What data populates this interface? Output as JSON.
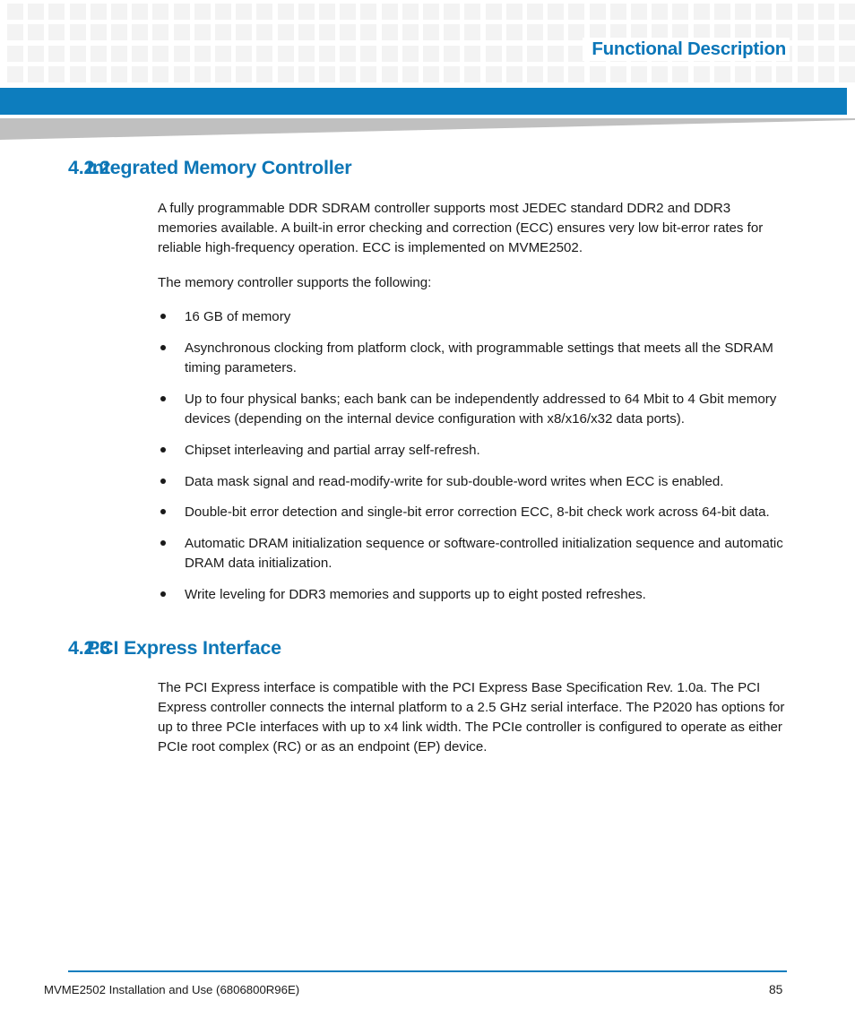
{
  "header": {
    "title": "Functional Description",
    "bar_color": "#0d7dbe",
    "wedge_color": "#c0c0c0",
    "grid_cell_color": "#f3f3f3"
  },
  "sections": [
    {
      "number": "4.2.2",
      "title": "Integrated Memory Controller",
      "paragraphs": [
        "A fully programmable DDR SDRAM controller supports most JEDEC standard DDR2 and DDR3 memories available. A built-in error checking and correction (ECC) ensures very low bit-error rates for reliable high-frequency operation. ECC is implemented on MVME2502.",
        "The memory controller supports the following:"
      ],
      "bullets": [
        "16 GB of memory",
        "Asynchronous clocking from platform clock, with programmable settings that meets all the SDRAM timing parameters.",
        "Up to four physical banks; each bank can be independently addressed to 64 Mbit to 4 Gbit memory devices (depending on the internal device configuration with x8/x16/x32 data ports).",
        "Chipset interleaving and partial array self-refresh.",
        "Data mask signal and read-modify-write for sub-double-word writes when ECC is enabled.",
        "Double-bit error detection and single-bit error correction ECC, 8-bit check work across 64-bit data.",
        "Automatic DRAM initialization sequence or software-controlled initialization sequence and automatic DRAM data initialization.",
        "Write leveling for DDR3 memories and supports up to eight posted refreshes."
      ]
    },
    {
      "number": "4.2.3",
      "title": "PCI Express Interface",
      "paragraphs": [
        "The PCI Express interface is compatible with the PCI Express Base Specification Rev. 1.0a. The PCI Express controller connects the internal platform to a 2.5 GHz serial interface. The P2020 has options for up to three PCIe interfaces with up to x4 link width. The PCIe controller is configured to operate as either PCIe root complex (RC) or as an endpoint (EP) device."
      ],
      "bullets": []
    }
  ],
  "footer": {
    "document_title": "MVME2502 Installation and Use (6806800R96E)",
    "page_number": "85",
    "rule_color": "#0d7dbe"
  }
}
